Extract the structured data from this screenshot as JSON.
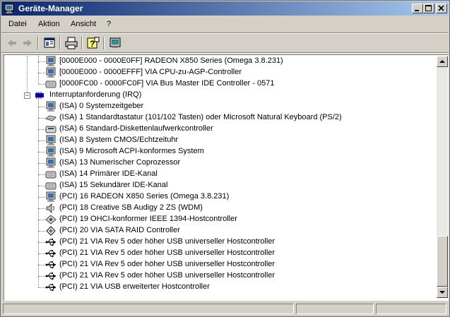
{
  "window": {
    "title": "Geräte-Manager"
  },
  "menu": [
    "Datei",
    "Aktion",
    "Ansicht",
    "?"
  ],
  "toolbar": {
    "buttons": [
      "back-arrow-icon",
      "forward-arrow-icon",
      "show-hide-tree-icon",
      "print-icon",
      "help-icon",
      "properties-icon"
    ]
  },
  "tree": {
    "io_rows": [
      {
        "icon": "monitor-icon",
        "text": "[0000E000 - 0000E0FF]  RADEON X850 Series (Omega 3.8.231)"
      },
      {
        "icon": "monitor-icon",
        "text": "[0000E000 - 0000EFFF]  VIA CPU-zu-AGP-Controller"
      },
      {
        "icon": "ide-controller-icon",
        "text": "[0000FC00 - 0000FC0F]  VIA Bus Master IDE Controller - 0571"
      }
    ],
    "irq_header": {
      "expander": "−",
      "text": "Interruptanforderung (IRQ)"
    },
    "irq_rows": [
      {
        "icon": "monitor-icon",
        "text": "(ISA)  0    Systemzeitgeber"
      },
      {
        "icon": "keyboard-icon",
        "text": "(ISA)  1    Standardtastatur (101/102 Tasten) oder Microsoft Natural Keyboard (PS/2)"
      },
      {
        "icon": "floppy-controller-icon",
        "text": "(ISA)  6    Standard-Diskettenlaufwerkcontroller"
      },
      {
        "icon": "monitor-icon",
        "text": "(ISA)  8    System CMOS/Echtzeituhr"
      },
      {
        "icon": "monitor-icon",
        "text": "(ISA)  9    Microsoft ACPI-konformes System"
      },
      {
        "icon": "monitor-icon",
        "text": "(ISA) 13    Numerischer Coprozessor"
      },
      {
        "icon": "ide-controller-icon",
        "text": "(ISA) 14    Primärer IDE-Kanal"
      },
      {
        "icon": "ide-controller-icon",
        "text": "(ISA) 15    Sekundärer IDE-Kanal"
      },
      {
        "icon": "monitor-icon",
        "text": "(PCI) 16    RADEON X850 Series (Omega 3.8.231)"
      },
      {
        "icon": "sound-icon",
        "text": "(PCI) 18    Creative SB Audigy 2 ZS (WDM)"
      },
      {
        "icon": "ieee1394-icon",
        "text": "(PCI) 19    OHCI-konformer IEEE 1394-Hostcontroller"
      },
      {
        "icon": "raid-controller-icon",
        "text": "(PCI) 20    VIA SATA RAID Controller"
      },
      {
        "icon": "usb-icon",
        "text": "(PCI) 21    VIA Rev 5 oder höher USB universeller Hostcontroller"
      },
      {
        "icon": "usb-icon",
        "text": "(PCI) 21    VIA Rev 5 oder höher USB universeller Hostcontroller"
      },
      {
        "icon": "usb-icon",
        "text": "(PCI) 21    VIA Rev 5 oder höher USB universeller Hostcontroller"
      },
      {
        "icon": "usb-icon",
        "text": "(PCI) 21    VIA Rev 5 oder höher USB universeller Hostcontroller"
      },
      {
        "icon": "usb-icon",
        "text": "(PCI) 21    VIA USB erweiterter Hostcontroller"
      }
    ]
  },
  "status": [
    "",
    "",
    ""
  ]
}
